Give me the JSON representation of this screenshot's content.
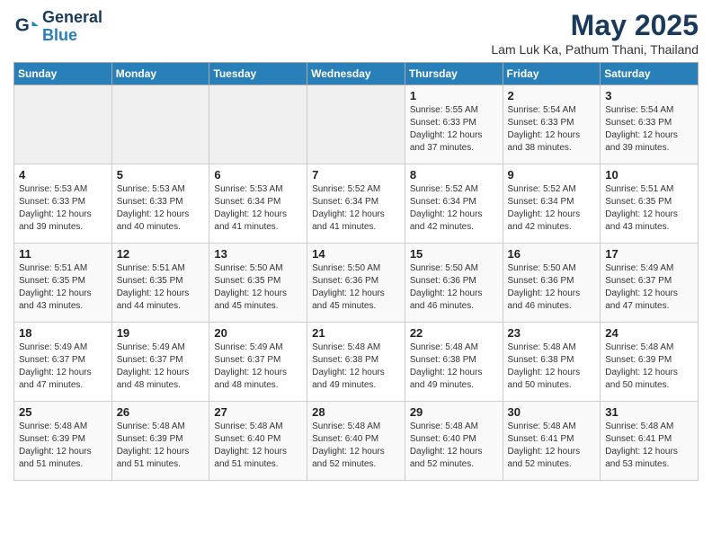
{
  "header": {
    "logo_line1": "General",
    "logo_line2": "Blue",
    "title": "May 2025",
    "subtitle": "Lam Luk Ka, Pathum Thani, Thailand"
  },
  "days_of_week": [
    "Sunday",
    "Monday",
    "Tuesday",
    "Wednesday",
    "Thursday",
    "Friday",
    "Saturday"
  ],
  "weeks": [
    [
      {
        "day": "",
        "info": ""
      },
      {
        "day": "",
        "info": ""
      },
      {
        "day": "",
        "info": ""
      },
      {
        "day": "",
        "info": ""
      },
      {
        "day": "1",
        "info": "Sunrise: 5:55 AM\nSunset: 6:33 PM\nDaylight: 12 hours\nand 37 minutes."
      },
      {
        "day": "2",
        "info": "Sunrise: 5:54 AM\nSunset: 6:33 PM\nDaylight: 12 hours\nand 38 minutes."
      },
      {
        "day": "3",
        "info": "Sunrise: 5:54 AM\nSunset: 6:33 PM\nDaylight: 12 hours\nand 39 minutes."
      }
    ],
    [
      {
        "day": "4",
        "info": "Sunrise: 5:53 AM\nSunset: 6:33 PM\nDaylight: 12 hours\nand 39 minutes."
      },
      {
        "day": "5",
        "info": "Sunrise: 5:53 AM\nSunset: 6:33 PM\nDaylight: 12 hours\nand 40 minutes."
      },
      {
        "day": "6",
        "info": "Sunrise: 5:53 AM\nSunset: 6:34 PM\nDaylight: 12 hours\nand 41 minutes."
      },
      {
        "day": "7",
        "info": "Sunrise: 5:52 AM\nSunset: 6:34 PM\nDaylight: 12 hours\nand 41 minutes."
      },
      {
        "day": "8",
        "info": "Sunrise: 5:52 AM\nSunset: 6:34 PM\nDaylight: 12 hours\nand 42 minutes."
      },
      {
        "day": "9",
        "info": "Sunrise: 5:52 AM\nSunset: 6:34 PM\nDaylight: 12 hours\nand 42 minutes."
      },
      {
        "day": "10",
        "info": "Sunrise: 5:51 AM\nSunset: 6:35 PM\nDaylight: 12 hours\nand 43 minutes."
      }
    ],
    [
      {
        "day": "11",
        "info": "Sunrise: 5:51 AM\nSunset: 6:35 PM\nDaylight: 12 hours\nand 43 minutes."
      },
      {
        "day": "12",
        "info": "Sunrise: 5:51 AM\nSunset: 6:35 PM\nDaylight: 12 hours\nand 44 minutes."
      },
      {
        "day": "13",
        "info": "Sunrise: 5:50 AM\nSunset: 6:35 PM\nDaylight: 12 hours\nand 45 minutes."
      },
      {
        "day": "14",
        "info": "Sunrise: 5:50 AM\nSunset: 6:36 PM\nDaylight: 12 hours\nand 45 minutes."
      },
      {
        "day": "15",
        "info": "Sunrise: 5:50 AM\nSunset: 6:36 PM\nDaylight: 12 hours\nand 46 minutes."
      },
      {
        "day": "16",
        "info": "Sunrise: 5:50 AM\nSunset: 6:36 PM\nDaylight: 12 hours\nand 46 minutes."
      },
      {
        "day": "17",
        "info": "Sunrise: 5:49 AM\nSunset: 6:37 PM\nDaylight: 12 hours\nand 47 minutes."
      }
    ],
    [
      {
        "day": "18",
        "info": "Sunrise: 5:49 AM\nSunset: 6:37 PM\nDaylight: 12 hours\nand 47 minutes."
      },
      {
        "day": "19",
        "info": "Sunrise: 5:49 AM\nSunset: 6:37 PM\nDaylight: 12 hours\nand 48 minutes."
      },
      {
        "day": "20",
        "info": "Sunrise: 5:49 AM\nSunset: 6:37 PM\nDaylight: 12 hours\nand 48 minutes."
      },
      {
        "day": "21",
        "info": "Sunrise: 5:48 AM\nSunset: 6:38 PM\nDaylight: 12 hours\nand 49 minutes."
      },
      {
        "day": "22",
        "info": "Sunrise: 5:48 AM\nSunset: 6:38 PM\nDaylight: 12 hours\nand 49 minutes."
      },
      {
        "day": "23",
        "info": "Sunrise: 5:48 AM\nSunset: 6:38 PM\nDaylight: 12 hours\nand 50 minutes."
      },
      {
        "day": "24",
        "info": "Sunrise: 5:48 AM\nSunset: 6:39 PM\nDaylight: 12 hours\nand 50 minutes."
      }
    ],
    [
      {
        "day": "25",
        "info": "Sunrise: 5:48 AM\nSunset: 6:39 PM\nDaylight: 12 hours\nand 51 minutes."
      },
      {
        "day": "26",
        "info": "Sunrise: 5:48 AM\nSunset: 6:39 PM\nDaylight: 12 hours\nand 51 minutes."
      },
      {
        "day": "27",
        "info": "Sunrise: 5:48 AM\nSunset: 6:40 PM\nDaylight: 12 hours\nand 51 minutes."
      },
      {
        "day": "28",
        "info": "Sunrise: 5:48 AM\nSunset: 6:40 PM\nDaylight: 12 hours\nand 52 minutes."
      },
      {
        "day": "29",
        "info": "Sunrise: 5:48 AM\nSunset: 6:40 PM\nDaylight: 12 hours\nand 52 minutes."
      },
      {
        "day": "30",
        "info": "Sunrise: 5:48 AM\nSunset: 6:41 PM\nDaylight: 12 hours\nand 52 minutes."
      },
      {
        "day": "31",
        "info": "Sunrise: 5:48 AM\nSunset: 6:41 PM\nDaylight: 12 hours\nand 53 minutes."
      }
    ]
  ]
}
